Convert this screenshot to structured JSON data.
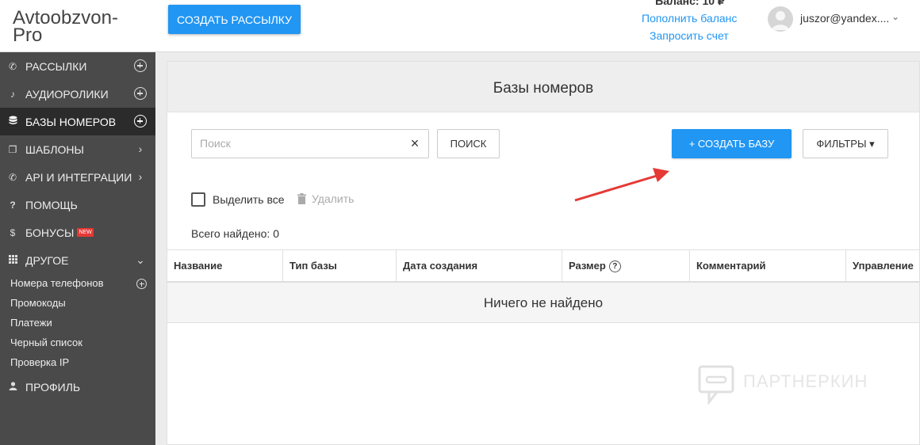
{
  "header": {
    "logo": "Avtoobzvon-Pro",
    "create_mailing": "СОЗДАТЬ РАССЫЛКУ",
    "balance": "Баланс: 10 ₽",
    "topup": "Пополнить баланс",
    "invoice": "Запросить счет",
    "user_email": "juszor@yandex...."
  },
  "sidebar": {
    "items": [
      {
        "label": "РАССЫЛКИ",
        "icon": "phone-icon",
        "right": "plus-circle-icon"
      },
      {
        "label": "АУДИОРОЛИКИ",
        "icon": "music-note-icon",
        "right": "plus-circle-icon"
      },
      {
        "label": "БАЗЫ НОМЕРОВ",
        "icon": "database-icon",
        "right": "plus-circle-icon",
        "active": true
      },
      {
        "label": "ШАБЛОНЫ",
        "icon": "file-copy-icon",
        "right": "chevron-right-icon"
      },
      {
        "label": "API И ИНТЕГРАЦИИ",
        "icon": "phone-forward-icon",
        "right": "chevron-right-icon"
      },
      {
        "label": "ПОМОЩЬ",
        "icon": "question-icon"
      },
      {
        "label": "БОНУСЫ",
        "icon": "dollar-icon",
        "badge": "NEW"
      },
      {
        "label": "ДРУГОЕ",
        "icon": "grid-icon",
        "right": "chevron-down-icon"
      },
      {
        "label": "ПРОФИЛЬ",
        "icon": "person-icon"
      }
    ],
    "subitems": [
      "Номера телефонов",
      "Промокоды",
      "Платежи",
      "Черный список",
      "Проверка IP"
    ]
  },
  "main": {
    "title": "Базы номеров",
    "search_placeholder": "Поиск",
    "search_button": "ПОИСК",
    "create_base": "+ СОЗДАТЬ БАЗУ",
    "filters": "ФИЛЬТРЫ ▾",
    "select_all": "Выделить все",
    "delete": "Удалить",
    "total": "Всего найдено: 0",
    "columns": [
      "Название",
      "Тип базы",
      "Дата создания",
      "Размер",
      "Комментарий",
      "Управление"
    ],
    "empty": "Ничего не найдено"
  },
  "watermark": "ПАРТНЕРКИН",
  "colors": {
    "accent": "#2196f3",
    "sidebar": "#4a4a4a",
    "sidebar_active": "#2b2b2b",
    "arrow": "#e53935"
  }
}
